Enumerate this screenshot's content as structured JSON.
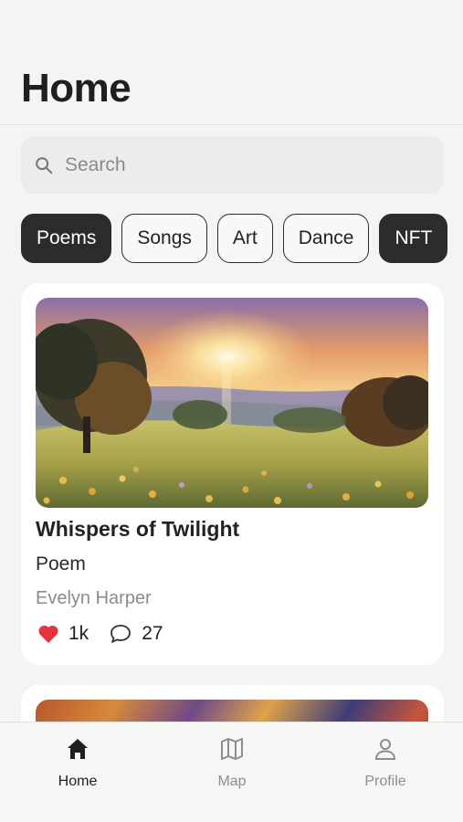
{
  "header": {
    "title": "Home"
  },
  "search": {
    "placeholder": "Search",
    "value": ""
  },
  "categories": [
    {
      "label": "Poems",
      "active": true
    },
    {
      "label": "Songs",
      "active": false
    },
    {
      "label": "Art",
      "active": false
    },
    {
      "label": "Dance",
      "active": false
    },
    {
      "label": "NFT",
      "active": true
    }
  ],
  "feed": [
    {
      "title": "Whispers of Twilight",
      "type": "Poem",
      "author": "Evelyn Harper",
      "likes": "1k",
      "comments": "27",
      "like_icon": "heart-icon",
      "comment_icon": "speech-bubble-icon",
      "like_color": "#e5343b"
    }
  ],
  "tabbar": {
    "items": [
      {
        "label": "Home",
        "icon": "home-icon",
        "active": true
      },
      {
        "label": "Map",
        "icon": "map-icon",
        "active": false
      },
      {
        "label": "Profile",
        "icon": "person-icon",
        "active": false
      }
    ]
  },
  "colors": {
    "background": "#f4f4f2",
    "chip_active": "#2c2c2c",
    "text_primary": "#222222",
    "text_muted": "#8b8b8b"
  }
}
